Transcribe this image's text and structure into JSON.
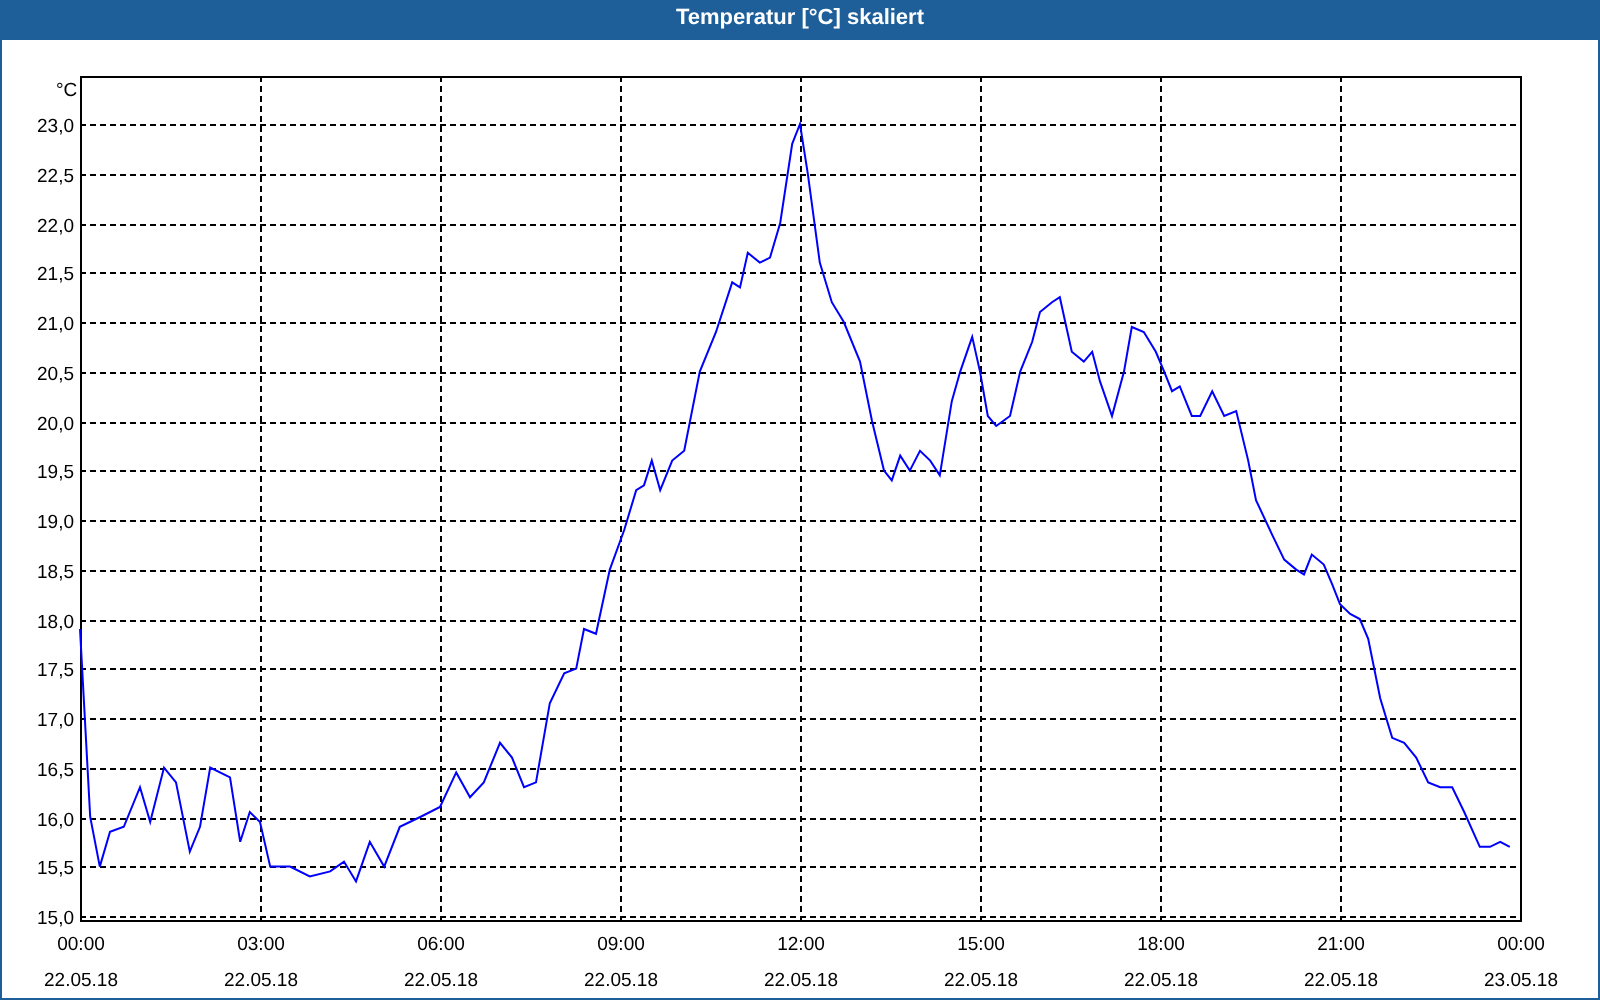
{
  "window": {
    "title": "Temperatur [°C] skaliert"
  },
  "chart": {
    "unit": "°C",
    "dates": [
      "22.05.18",
      "22.05.18",
      "22.05.18",
      "22.05.18",
      "22.05.18",
      "22.05.18",
      "22.05.18",
      "22.05.18",
      "23.05.18"
    ],
    "chart_data": {
      "type": "line",
      "x": [
        0,
        0.17,
        0.33,
        0.5,
        0.73,
        1.0,
        1.17,
        1.4,
        1.6,
        1.83,
        2.0,
        2.17,
        2.5,
        2.67,
        2.83,
        3.0,
        3.17,
        3.5,
        3.83,
        4.17,
        4.4,
        4.6,
        4.83,
        5.07,
        5.33,
        5.67,
        6.0,
        6.27,
        6.5,
        6.73,
        7.0,
        7.2,
        7.4,
        7.6,
        7.83,
        8.07,
        8.27,
        8.4,
        8.6,
        8.83,
        9.07,
        9.27,
        9.4,
        9.53,
        9.67,
        9.87,
        10.07,
        10.33,
        10.6,
        10.87,
        11.0,
        11.13,
        11.33,
        11.5,
        11.67,
        11.87,
        12.0,
        12.13,
        12.33,
        12.53,
        12.73,
        13.0,
        13.2,
        13.4,
        13.53,
        13.67,
        13.83,
        14.0,
        14.17,
        14.33,
        14.53,
        14.67,
        14.87,
        15.0,
        15.13,
        15.27,
        15.5,
        15.67,
        15.87,
        16.0,
        16.2,
        16.33,
        16.53,
        16.73,
        16.87,
        17.0,
        17.2,
        17.4,
        17.53,
        17.73,
        17.93,
        18.07,
        18.2,
        18.33,
        18.53,
        18.67,
        18.87,
        19.07,
        19.27,
        19.47,
        19.6,
        19.87,
        20.07,
        20.27,
        20.4,
        20.53,
        20.73,
        20.87,
        21.0,
        21.17,
        21.33,
        21.47,
        21.67,
        21.87,
        22.07,
        22.27,
        22.47,
        22.67,
        22.87,
        23.07,
        23.33,
        23.5,
        23.67,
        23.83
      ],
      "series": [
        {
          "color": "#0000ff",
          "values": [
            17.9,
            16.0,
            15.5,
            15.85,
            15.9,
            16.3,
            15.95,
            16.5,
            16.35,
            15.65,
            15.9,
            16.5,
            16.4,
            15.75,
            16.05,
            15.95,
            15.5,
            15.5,
            15.4,
            15.45,
            15.55,
            15.35,
            15.75,
            15.5,
            15.9,
            16.0,
            16.1,
            16.45,
            16.2,
            16.35,
            16.75,
            16.6,
            16.3,
            16.35,
            17.15,
            17.45,
            17.5,
            17.9,
            17.85,
            18.5,
            18.9,
            19.3,
            19.35,
            19.6,
            19.3,
            19.6,
            19.7,
            20.5,
            20.9,
            21.4,
            21.35,
            21.7,
            21.6,
            21.65,
            22.0,
            22.8,
            23.0,
            22.5,
            21.6,
            21.2,
            21.0,
            20.6,
            20.0,
            19.5,
            19.4,
            19.65,
            19.5,
            19.7,
            19.6,
            19.45,
            20.2,
            20.5,
            20.85,
            20.5,
            20.05,
            19.95,
            20.05,
            20.5,
            20.8,
            21.1,
            21.2,
            21.25,
            20.7,
            20.6,
            20.7,
            20.4,
            20.05,
            20.5,
            20.95,
            20.9,
            20.7,
            20.5,
            20.3,
            20.35,
            20.05,
            20.05,
            20.3,
            20.05,
            20.1,
            19.6,
            19.2,
            18.85,
            18.6,
            18.5,
            18.45,
            18.65,
            18.55,
            18.35,
            18.15,
            18.05,
            18.0,
            17.8,
            17.2,
            16.8,
            16.75,
            16.6,
            16.35,
            16.3,
            16.3,
            16.05,
            15.7,
            15.7,
            15.75,
            15.7
          ]
        }
      ],
      "grid": true,
      "xlim": [
        0,
        24
      ],
      "ylim": [
        15,
        23
      ],
      "xticks": [
        {
          "value": 0,
          "label": "00:00"
        },
        {
          "value": 3,
          "label": "03:00"
        },
        {
          "value": 6,
          "label": "06:00"
        },
        {
          "value": 9,
          "label": "09:00"
        },
        {
          "value": 12,
          "label": "12:00"
        },
        {
          "value": 15,
          "label": "15:00"
        },
        {
          "value": 18,
          "label": "18:00"
        },
        {
          "value": 21,
          "label": "21:00"
        },
        {
          "value": 24,
          "label": "00:00"
        }
      ],
      "yticks": [
        {
          "value": 15,
          "label": "15,0"
        },
        {
          "value": 15.5,
          "label": "15,5"
        },
        {
          "value": 16,
          "label": "16,0"
        },
        {
          "value": 16.5,
          "label": "16,5"
        },
        {
          "value": 17,
          "label": "17,0"
        },
        {
          "value": 17.5,
          "label": "17,5"
        },
        {
          "value": 18,
          "label": "18,0"
        },
        {
          "value": 18.5,
          "label": "18,5"
        },
        {
          "value": 19,
          "label": "19,0"
        },
        {
          "value": 19.5,
          "label": "19,5"
        },
        {
          "value": 20,
          "label": "20,0"
        },
        {
          "value": 20.5,
          "label": "20,5"
        },
        {
          "value": 21,
          "label": "21,0"
        },
        {
          "value": 21.5,
          "label": "21,5"
        },
        {
          "value": 22,
          "label": "22,0"
        },
        {
          "value": 22.5,
          "label": "22,5"
        },
        {
          "value": 23,
          "label": "23,0"
        }
      ]
    }
  }
}
